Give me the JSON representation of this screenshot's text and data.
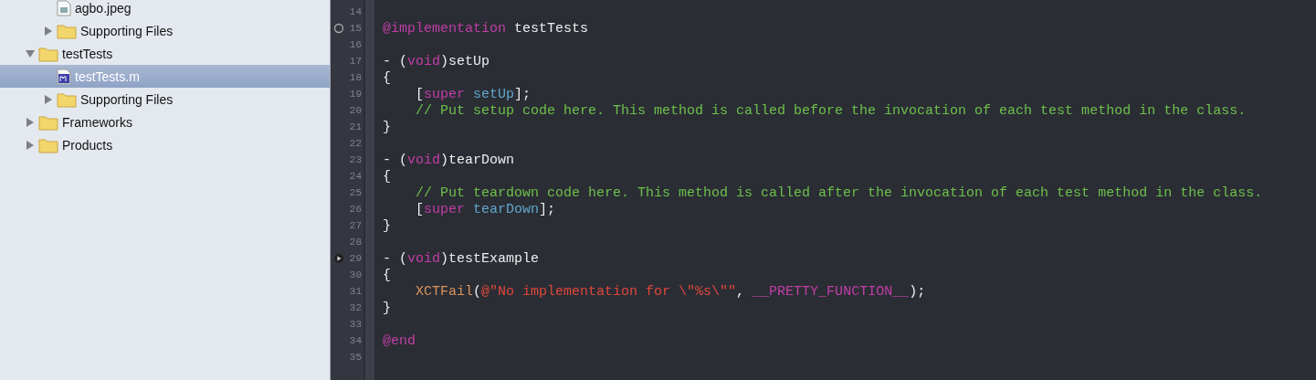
{
  "navigator": {
    "tree": [
      {
        "children": [
          {
            "kind": "image",
            "name": "agbo.jpeg",
            "selected": false
          },
          {
            "kind": "folder",
            "name": "Supporting Files",
            "expanded": false,
            "selected": false
          }
        ]
      },
      {
        "kind": "folder",
        "name": "testTests",
        "expanded": true,
        "selected": false,
        "children": [
          {
            "kind": "source",
            "name": "testTests.m",
            "selected": true
          },
          {
            "kind": "folder",
            "name": "Supporting Files",
            "expanded": false,
            "selected": false
          }
        ]
      },
      {
        "kind": "folder",
        "name": "Frameworks",
        "expanded": false,
        "selected": false
      },
      {
        "kind": "folder",
        "name": "Products",
        "expanded": false,
        "selected": false
      }
    ]
  },
  "editor": {
    "lines": [
      {
        "number": "14"
      },
      {
        "number": "15",
        "test": true,
        "test_ran": false,
        "tokens": [
          {
            "kind": "keyword",
            "text": "@implementation"
          },
          {
            "kind": "plain",
            "text": " testTests"
          }
        ]
      },
      {
        "number": "16"
      },
      {
        "number": "17",
        "tokens": [
          {
            "kind": "plain",
            "text": "- ("
          },
          {
            "kind": "keyword",
            "text": "void"
          },
          {
            "kind": "plain",
            "text": ")setUp"
          }
        ]
      },
      {
        "number": "18",
        "tokens": [
          {
            "kind": "plain",
            "text": "{"
          }
        ]
      },
      {
        "number": "19",
        "tokens": [
          {
            "kind": "plain",
            "text": "    ["
          },
          {
            "kind": "keyword",
            "text": "super"
          },
          {
            "kind": "method",
            "text": " setUp"
          },
          {
            "kind": "plain",
            "text": "];"
          }
        ]
      },
      {
        "number": "20",
        "tokens": [
          {
            "kind": "comment",
            "text": "    // Put setup code here. This method is called before the invocation of each test method in the class."
          }
        ]
      },
      {
        "number": "21",
        "tokens": [
          {
            "kind": "plain",
            "text": "}"
          }
        ]
      },
      {
        "number": "22"
      },
      {
        "number": "23",
        "tokens": [
          {
            "kind": "plain",
            "text": "- ("
          },
          {
            "kind": "keyword",
            "text": "void"
          },
          {
            "kind": "plain",
            "text": ")tearDown"
          }
        ]
      },
      {
        "number": "24",
        "tokens": [
          {
            "kind": "plain",
            "text": "{"
          }
        ]
      },
      {
        "number": "25",
        "tokens": [
          {
            "kind": "comment",
            "text": "    // Put teardown code here. This method is called after the invocation of each test method in the class."
          }
        ]
      },
      {
        "number": "26",
        "tokens": [
          {
            "kind": "plain",
            "text": "    ["
          },
          {
            "kind": "keyword",
            "text": "super"
          },
          {
            "kind": "method",
            "text": " tearDown"
          },
          {
            "kind": "plain",
            "text": "];"
          }
        ]
      },
      {
        "number": "27",
        "tokens": [
          {
            "kind": "plain",
            "text": "}"
          }
        ]
      },
      {
        "number": "28"
      },
      {
        "number": "29",
        "test": true,
        "test_ran": true,
        "tokens": [
          {
            "kind": "plain",
            "text": "- ("
          },
          {
            "kind": "keyword",
            "text": "void"
          },
          {
            "kind": "plain",
            "text": ")testExample"
          }
        ]
      },
      {
        "number": "30",
        "tokens": [
          {
            "kind": "plain",
            "text": "{"
          }
        ]
      },
      {
        "number": "31",
        "tokens": [
          {
            "kind": "macro",
            "text": "    XCTFail"
          },
          {
            "kind": "plain",
            "text": "("
          },
          {
            "kind": "string",
            "text": "@\"No implementation for \\\"%s\\\"\""
          },
          {
            "kind": "plain",
            "text": ", "
          },
          {
            "kind": "keyword",
            "text": "__PRETTY_FUNCTION__"
          },
          {
            "kind": "plain",
            "text": ");"
          }
        ]
      },
      {
        "number": "32",
        "tokens": [
          {
            "kind": "plain",
            "text": "}"
          }
        ]
      },
      {
        "number": "33"
      },
      {
        "number": "34",
        "tokens": [
          {
            "kind": "keyword",
            "text": "@end"
          }
        ]
      },
      {
        "number": "35"
      }
    ]
  }
}
